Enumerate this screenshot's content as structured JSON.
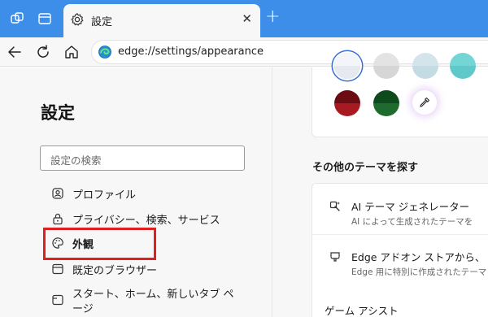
{
  "tab": {
    "title": "設定",
    "close_glyph": "✕"
  },
  "toolbar": {
    "url": "edge://settings/appearance"
  },
  "sidebar": {
    "title": "設定",
    "search_placeholder": "設定の検索",
    "items": [
      {
        "label": "プロファイル",
        "icon": "profile-icon"
      },
      {
        "label": "プライバシー、検索、サービス",
        "icon": "lock-icon"
      },
      {
        "label": "外観",
        "icon": "palette-icon",
        "active": true
      },
      {
        "label": "既定のブラウザー",
        "icon": "browser-icon"
      },
      {
        "label": "スタート、ホーム、新しいタブ ペ",
        "label2": "ージ",
        "icon": "tab-icon"
      }
    ]
  },
  "theme_colors": {
    "swatches": [
      {
        "top": "#f3f5f9",
        "bottom": "#e6e9ef",
        "selected": true
      },
      {
        "top": "#e3e3e3",
        "bottom": "#d6d6d6"
      },
      {
        "top": "#d3e5ea",
        "bottom": "#c3dbe2"
      },
      {
        "top": "#74d5d6",
        "bottom": "#5fc9ca"
      },
      {
        "top": "#6b0c12",
        "bottom": "#a81a22"
      },
      {
        "top": "#0f4a1c",
        "bottom": "#1f6b2e"
      }
    ],
    "picker_icon": "eyedropper-icon"
  },
  "more_themes": {
    "title": "その他のテーマを探す",
    "items": [
      {
        "title": "AI テーマ ジェネレーター",
        "subtitle": "AI によって生成されたテーマを",
        "icon": "ai-wand-icon"
      },
      {
        "title": "Edge アドオン ストアから、",
        "subtitle": "Edge 用に特別に作成されたテーマ",
        "icon": "store-icon"
      }
    ]
  },
  "game_assist": {
    "title": "ゲーム アシスト"
  },
  "colors": {
    "titlebar": "#3d8ee8",
    "highlight": "#e02020"
  }
}
